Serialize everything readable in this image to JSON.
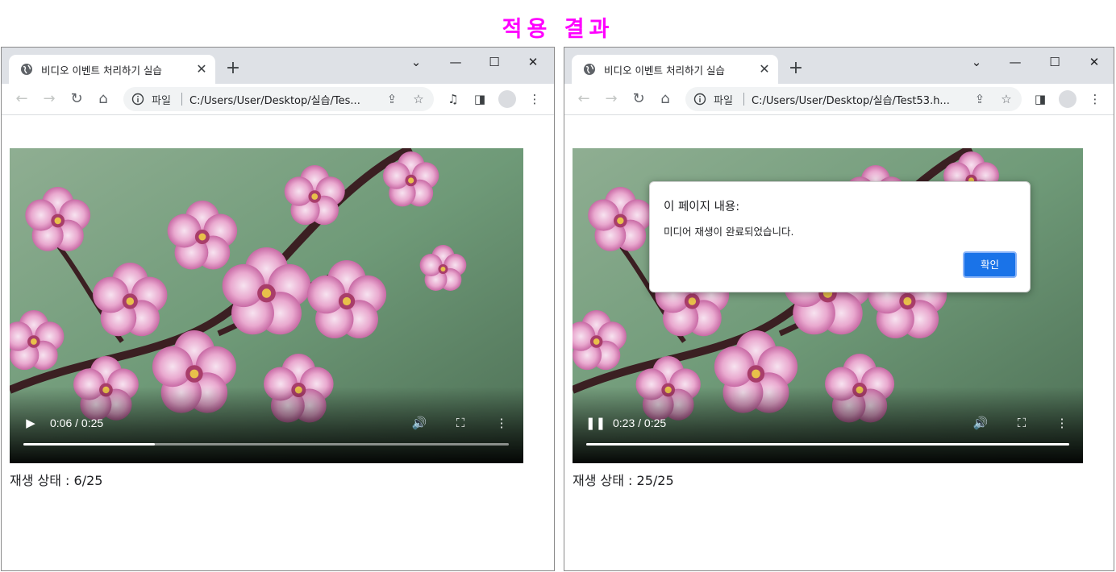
{
  "heading": "적용 결과",
  "colors": {
    "heading": "#ff00ff",
    "tabstrip": "#dee1e6",
    "omnibox": "#f1f3f4",
    "dialog_button": "#1a73e8"
  },
  "left_window": {
    "tab_title": "비디오 이벤트 처리하기 실습",
    "tab_close": "✕",
    "new_tab": "+",
    "window_controls": {
      "tab_search": "⌄",
      "minimize": "—",
      "maximize": "☐",
      "close": "✕"
    },
    "nav": {
      "back": "←",
      "forward": "→",
      "reload": "↻",
      "home": "⌂"
    },
    "omnibox": {
      "scheme": "파일",
      "url": "C:/Users/User/Desktop/실습/Tes..."
    },
    "toolbar_icons": {
      "share": "⇪",
      "bookmark": "☆",
      "media": "♫",
      "side_panel": "◨",
      "menu": "⋮"
    },
    "video": {
      "state": "paused",
      "play_icon": "▶",
      "time": "0:06 / 0:25",
      "volume_icon": "🔊",
      "fullscreen_icon": "⛶",
      "more_icon": "⋮",
      "progress": 0.27
    },
    "status_text": "재생 상태 : 6/25"
  },
  "right_window": {
    "tab_title": "비디오 이벤트 처리하기 실습",
    "tab_close": "✕",
    "new_tab": "+",
    "window_controls": {
      "tab_search": "⌄",
      "minimize": "—",
      "maximize": "☐",
      "close": "✕"
    },
    "nav": {
      "back": "←",
      "forward": "→",
      "reload": "↻",
      "home": "⌂"
    },
    "omnibox": {
      "scheme": "파일",
      "url": "C:/Users/User/Desktop/실습/Test53.h..."
    },
    "toolbar_icons": {
      "share": "⇪",
      "bookmark": "☆",
      "side_panel": "◨",
      "menu": "⋮"
    },
    "video": {
      "state": "playing",
      "pause_icon": "❚❚",
      "time": "0:23 / 0:25",
      "volume_icon": "🔊",
      "fullscreen_icon": "⛶",
      "more_icon": "⋮",
      "progress": 1.0
    },
    "status_text": "재생 상태 : 25/25",
    "dialog": {
      "title": "이 페이지 내용:",
      "message": "미디어 재생이 완료되었습니다.",
      "ok_label": "확인"
    }
  }
}
